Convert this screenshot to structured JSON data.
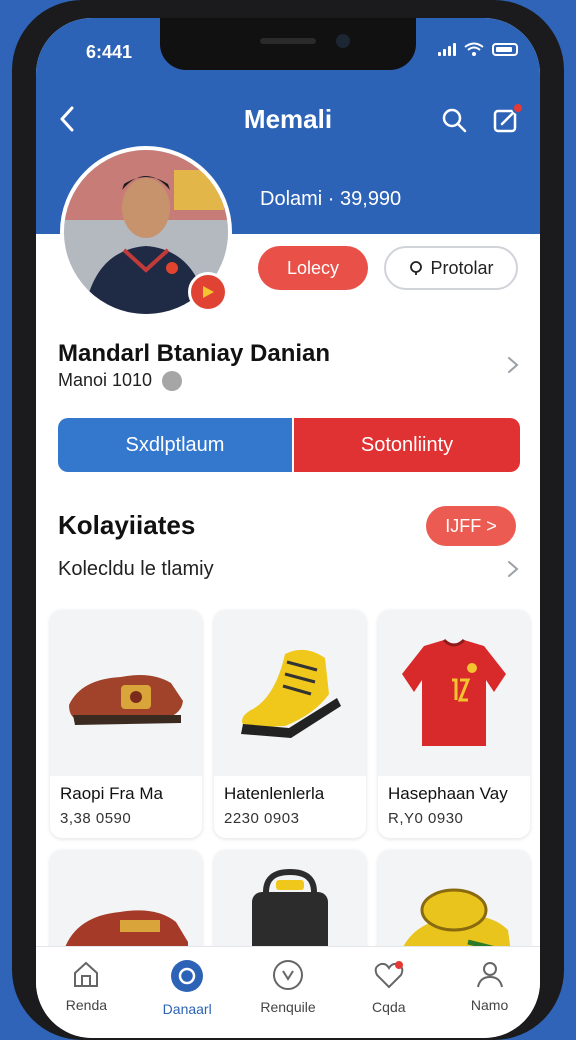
{
  "status": {
    "time": "6:441"
  },
  "nav": {
    "title": "Memali"
  },
  "profile": {
    "stat": "Dolami · 39,990",
    "btn_primary": "Lolecy",
    "btn_secondary": "Protolar",
    "name": "Mandarl Btaniay Danian",
    "subinfo": "Manoi 1010"
  },
  "segments": {
    "left": "Sxdlptlaum",
    "right": "Sotonliinty"
  },
  "section": {
    "title": "Kolayiiates",
    "more": "IJFF >",
    "subtitle": "Kolecldu le tlamiy"
  },
  "products": [
    {
      "title": "Raopi Fra Ma",
      "price": "3,38 0590"
    },
    {
      "title": "Hatenlenlerla",
      "price": "2230 0903"
    },
    {
      "title": "Hasephaan Vay",
      "price": "R,Y0 0930"
    }
  ],
  "tabs": [
    {
      "label": "Renda"
    },
    {
      "label": "Danaarl"
    },
    {
      "label": "Renquile"
    },
    {
      "label": "Cqda"
    },
    {
      "label": "Namo"
    }
  ],
  "colors": {
    "brand": "#2d63b6",
    "accent": "#e03232"
  }
}
